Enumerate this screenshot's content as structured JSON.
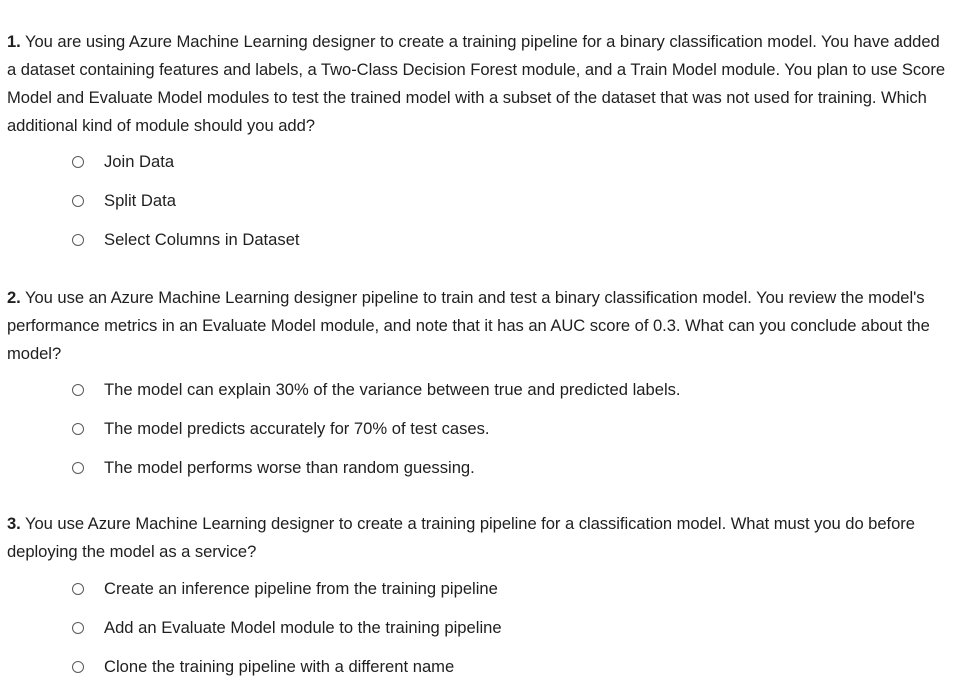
{
  "questions": [
    {
      "number": "1.",
      "text": " You are using Azure Machine Learning designer to create a training pipeline for a binary classification model. You have added a dataset containing features and labels, a Two-Class Decision Forest module, and a Train Model module. You plan to use Score Model and Evaluate Model modules to test the trained model with a subset of the dataset that was not used for training. Which additional kind of module should you add?",
      "options": [
        "Join Data",
        "Split Data",
        "Select Columns in Dataset"
      ]
    },
    {
      "number": "2.",
      "text": " You use an Azure Machine Learning designer pipeline to train and test a binary classification model. You review the model's performance metrics in an Evaluate Model module, and note that it has an AUC score of 0.3. What can you conclude about the model?",
      "options": [
        "The model can explain 30% of the variance between true and predicted labels.",
        "The model predicts accurately for 70% of test cases.",
        "The model performs worse than random guessing."
      ]
    },
    {
      "number": "3.",
      "text": " You use Azure Machine Learning designer to create a training pipeline for a classification model. What must you do before deploying the model as a service?",
      "options": [
        "Create an inference pipeline from the training pipeline",
        "Add an Evaluate Model module to the training pipeline",
        "Clone the training pipeline with a different name"
      ]
    }
  ]
}
